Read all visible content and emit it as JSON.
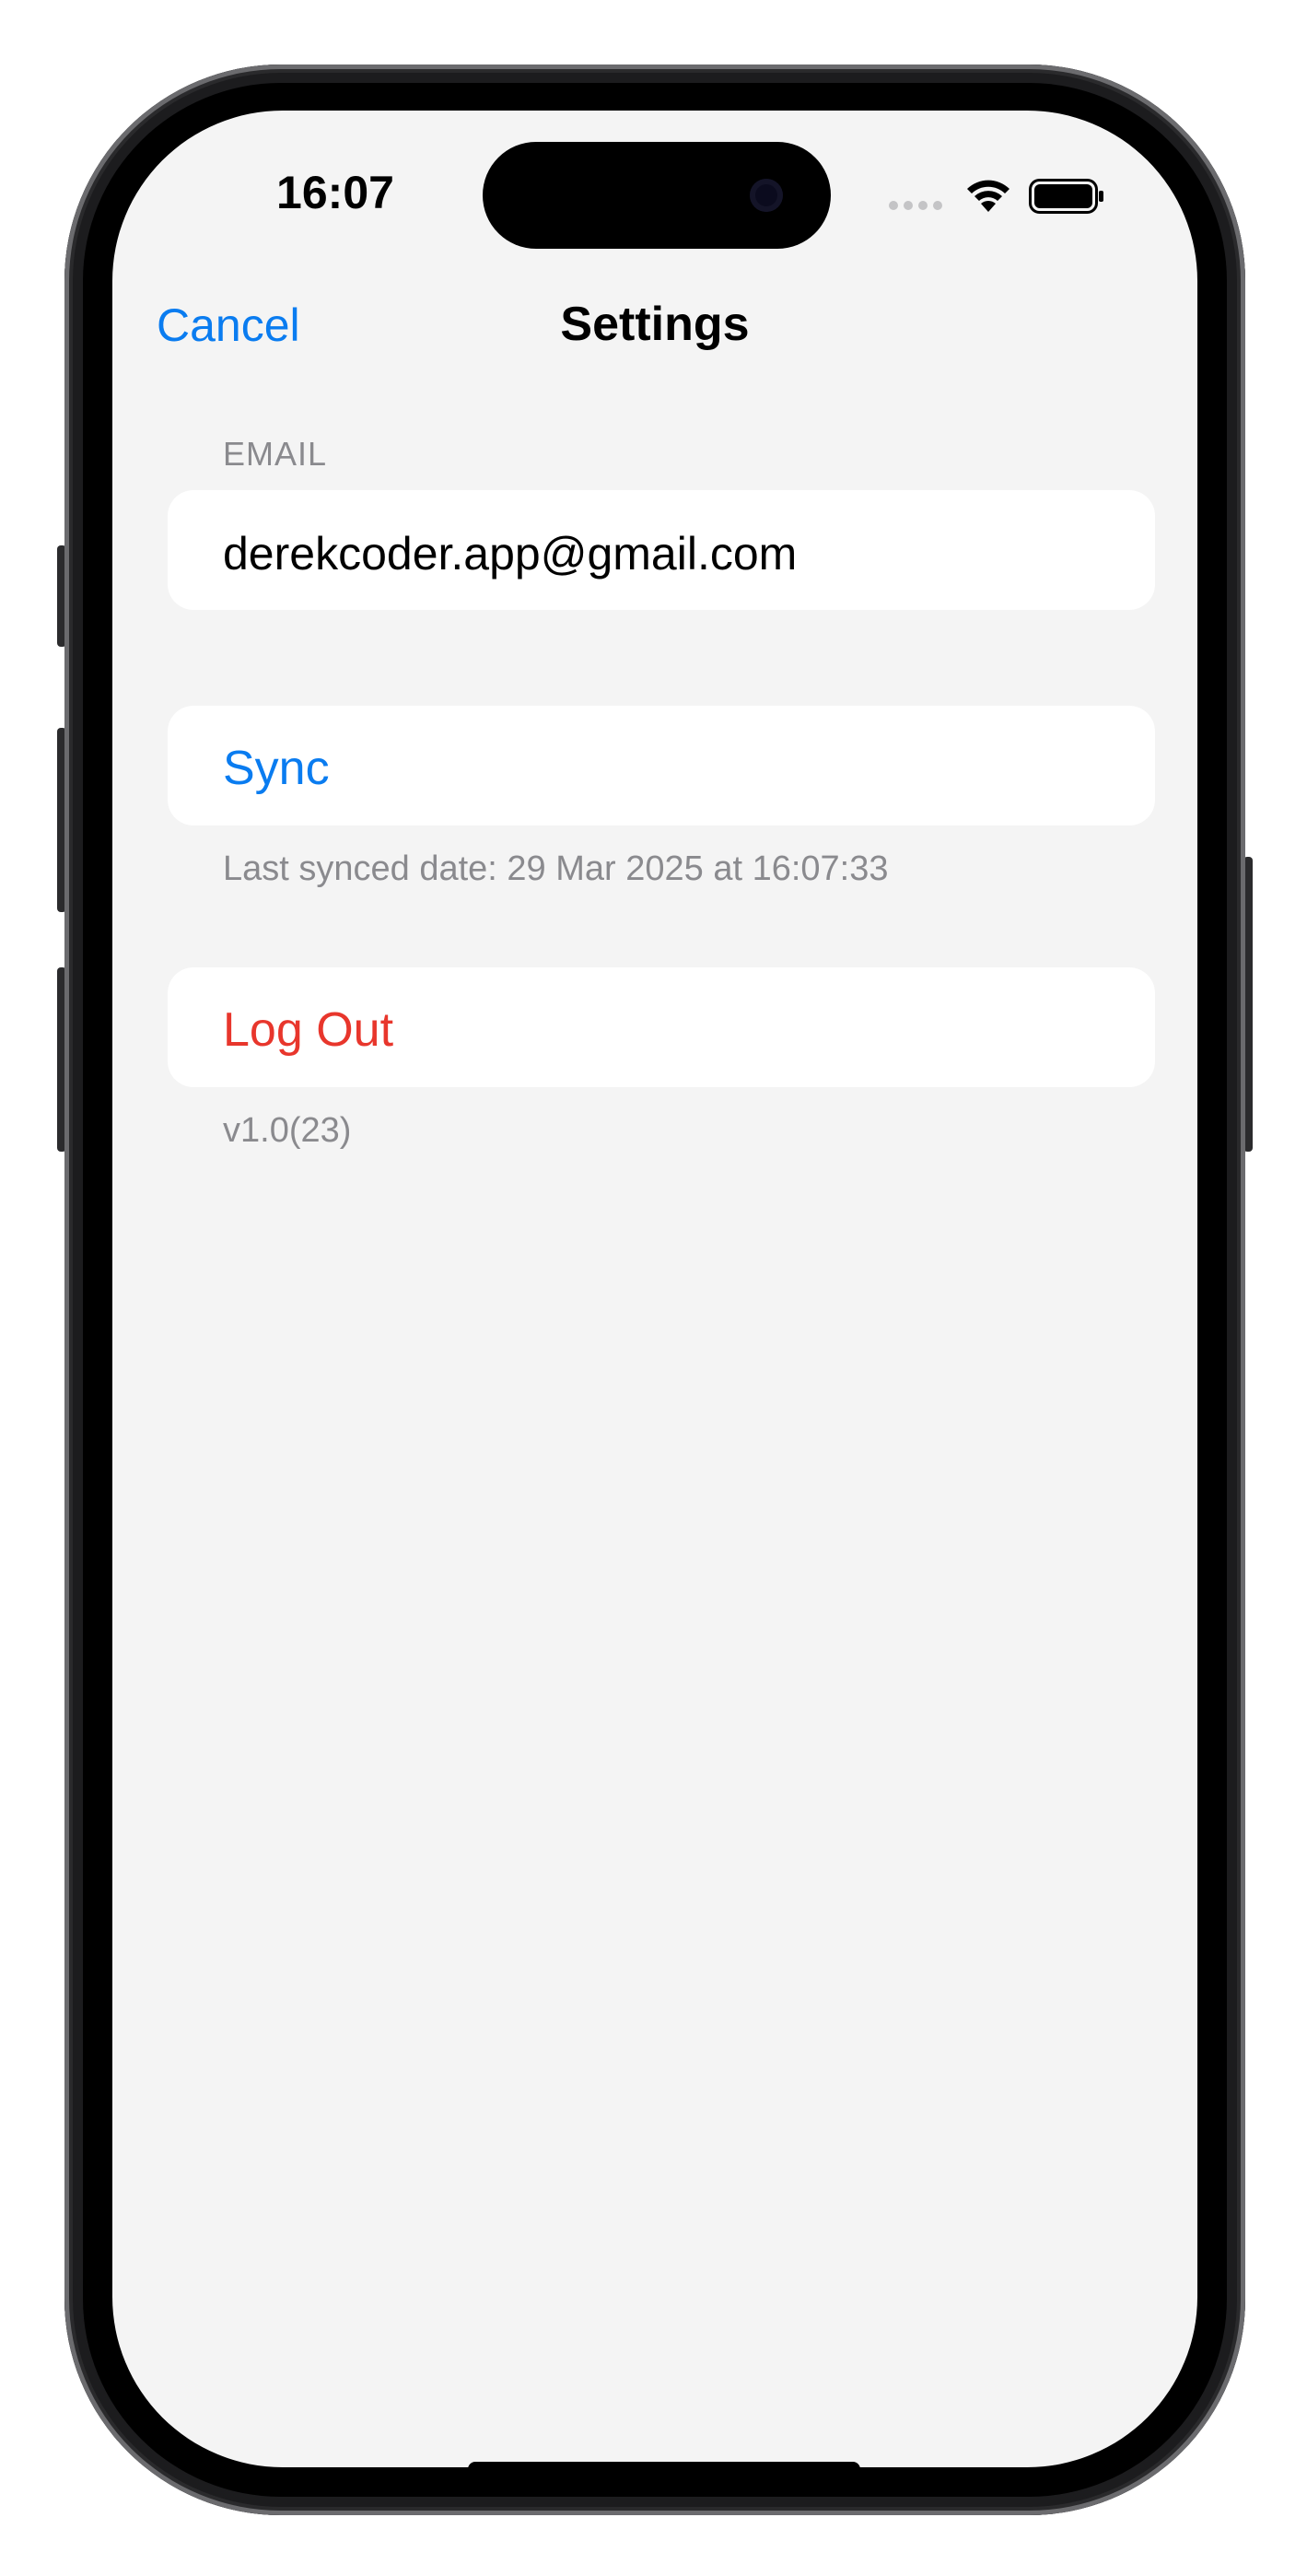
{
  "status_bar": {
    "time": "16:07"
  },
  "nav": {
    "cancel_label": "Cancel",
    "title": "Settings"
  },
  "email_section": {
    "header": "EMAIL",
    "value": "derekcoder.app@gmail.com"
  },
  "sync_section": {
    "button_label": "Sync",
    "footer": "Last synced date: 29 Mar 2025 at 16:07:33"
  },
  "logout_section": {
    "button_label": "Log Out",
    "footer": "v1.0(23)"
  },
  "colors": {
    "accent": "#0a7cf0",
    "destructive": "#e8362c",
    "background": "#f4f4f4",
    "card": "#ffffff",
    "secondary_text": "#8a8a8e"
  },
  "icons": [
    "signal-icon",
    "wifi-icon",
    "battery-icon"
  ]
}
